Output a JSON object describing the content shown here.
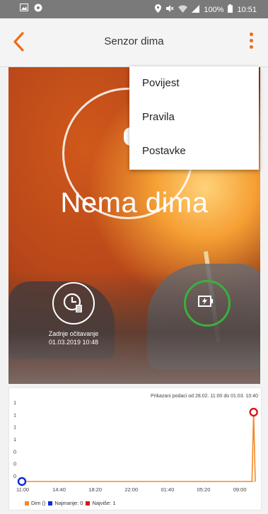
{
  "status_bar": {
    "battery": "100%",
    "time": "10:51"
  },
  "app_bar": {
    "title": "Senzor dima"
  },
  "menu": {
    "items": [
      {
        "label": "Povijest"
      },
      {
        "label": "Pravila"
      },
      {
        "label": "Postavke"
      }
    ]
  },
  "hero": {
    "status_text": "Nema dima",
    "last_reading_label": "Zadnje očitavanje",
    "last_reading_time": "01.03.2019 10:48",
    "battery_ring_color": "#38b23a",
    "accent_color": "#f06a1b"
  },
  "chart_data": {
    "type": "line",
    "subtitle": "Prikazani podaci od 28.02. 11:00 do 01.03. 10:40",
    "x_ticks": [
      "11:00",
      "14:40",
      "18:20",
      "22:00",
      "01:40",
      "05:20",
      "09:00"
    ],
    "y_ticks": [
      "1",
      "1",
      "1",
      "1",
      "0",
      "0",
      "0"
    ],
    "ylim": [
      0,
      1
    ],
    "series": [
      {
        "name": "Dim ()",
        "color": "#f08a2b"
      }
    ],
    "points": [
      {
        "x": "11:00",
        "y": 0
      },
      {
        "x": "10:20",
        "y": 0
      },
      {
        "x": "10:30",
        "y": 1
      },
      {
        "x": "10:40",
        "y": 0
      }
    ],
    "min_marker": {
      "x": "11:00",
      "y": 0,
      "color": "#0a2bd6"
    },
    "max_marker": {
      "x": "10:30",
      "y": 1,
      "color": "#d21a1a"
    },
    "legend": [
      {
        "label": "Dim ()",
        "color": "#f08a2b"
      },
      {
        "label": "Najmanje: 0",
        "color": "#0a2bd6"
      },
      {
        "label": "Najviše: 1",
        "color": "#d21a1a"
      }
    ]
  }
}
